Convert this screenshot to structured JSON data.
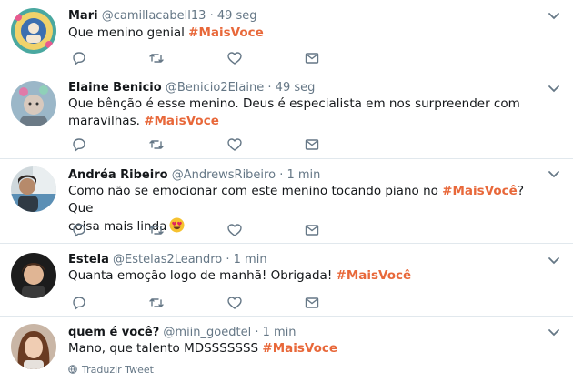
{
  "tweets": [
    {
      "name": "Mari",
      "handle": "@camillacabell13",
      "separator": "·",
      "time": "49 seg",
      "text_before": "Que menino genial ",
      "text_between": "",
      "text_after": "",
      "hashtag": "#MaisVoce",
      "avatar_icon": "user-avatar"
    },
    {
      "name": "Elaine Benicio",
      "handle": "@Benicio2Elaine",
      "separator": "·",
      "time": "49 seg",
      "text_before": "Que bênção é esse menino. Deus é especialista em nos surpreender com",
      "text_between": "maravilhas. ",
      "text_after": "",
      "hashtag": "#MaisVoce",
      "avatar_icon": "user-avatar"
    },
    {
      "name": "Andréa Ribeiro",
      "handle": "@AndrewsRibeiro",
      "separator": "·",
      "time": "1 min",
      "text_before": "Como não se emocionar com este menino tocando piano no ",
      "hashtag": "#MaisVocê",
      "text_after": "? Que",
      "text_line2": "coisa mais linda",
      "emoji": "heart-eyes-emoji",
      "avatar_icon": "user-avatar"
    },
    {
      "name": "Estela",
      "handle": "@Estelas2Leandro",
      "separator": "·",
      "time": "1 min",
      "text_before": "Quanta emoção logo de manhã! Obrigada! ",
      "hashtag": "#MaisVocê",
      "avatar_icon": "user-avatar"
    },
    {
      "name": "quem é você?",
      "handle": "@miin_goedtel",
      "separator": "·",
      "time": "1 min",
      "text_before": "Mano, que talento MDSSSSSSS ",
      "hashtag": "#MaisVoce",
      "avatar_icon": "user-avatar"
    }
  ],
  "translate_label": "Traduzir Tweet",
  "icons": {
    "reply": "reply-icon",
    "retweet": "retweet-icon",
    "like": "heart-icon",
    "dm": "envelope-icon",
    "menu": "chevron-down-icon",
    "translate": "globe-icon"
  },
  "colors": {
    "hashtag": "#e8683a",
    "meta": "#657786",
    "text": "#14171a",
    "divider": "#e1e8ed"
  }
}
